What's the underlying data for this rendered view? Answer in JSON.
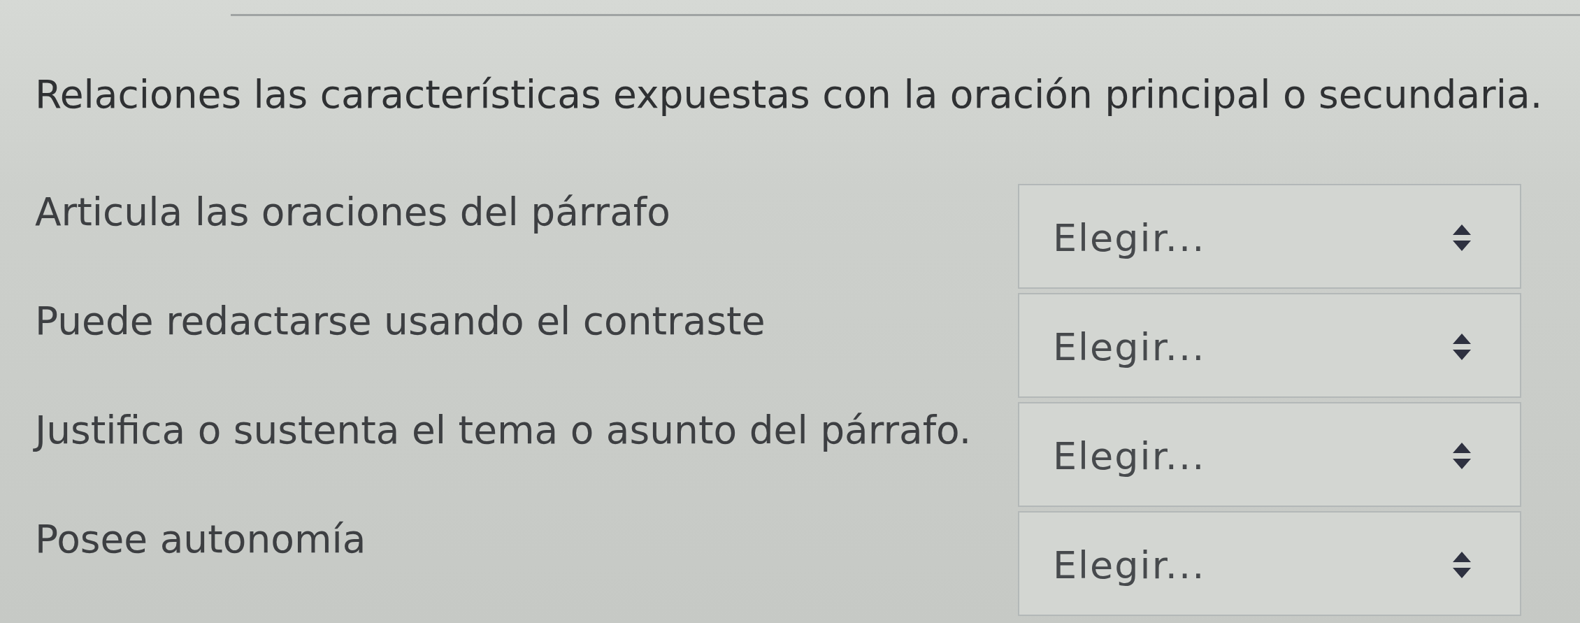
{
  "question": {
    "prompt": "Relaciones las características expuestas con la oración principal o secundaria."
  },
  "rows": [
    {
      "label": "Articula las oraciones del párrafo",
      "dropdown": {
        "value": "Elegir..."
      }
    },
    {
      "label": "Puede redactarse usando el contraste",
      "dropdown": {
        "value": "Elegir..."
      }
    },
    {
      "label": "Justifica o sustenta el tema o asunto del párrafo.",
      "dropdown": {
        "value": "Elegir..."
      }
    },
    {
      "label": "Posee autonomía",
      "dropdown": {
        "value": "Elegir..."
      }
    }
  ]
}
